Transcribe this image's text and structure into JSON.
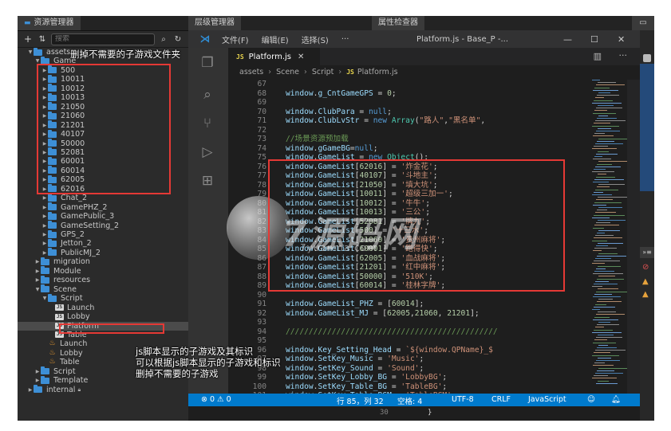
{
  "assets_panel": {
    "title": "资源管理器",
    "search_placeholder": "搜索",
    "rows": [
      {
        "label": "assets",
        "level": 0,
        "type": "folder",
        "expanded": true
      },
      {
        "label": "Game",
        "level": 1,
        "type": "folder",
        "expanded": true
      },
      {
        "label": "500",
        "level": 2,
        "type": "folder"
      },
      {
        "label": "10011",
        "level": 2,
        "type": "folder"
      },
      {
        "label": "10012",
        "level": 2,
        "type": "folder"
      },
      {
        "label": "10013",
        "level": 2,
        "type": "folder"
      },
      {
        "label": "21050",
        "level": 2,
        "type": "folder"
      },
      {
        "label": "21060",
        "level": 2,
        "type": "folder"
      },
      {
        "label": "21201",
        "level": 2,
        "type": "folder"
      },
      {
        "label": "40107",
        "level": 2,
        "type": "folder"
      },
      {
        "label": "50000",
        "level": 2,
        "type": "folder"
      },
      {
        "label": "52081",
        "level": 2,
        "type": "folder"
      },
      {
        "label": "60001",
        "level": 2,
        "type": "folder"
      },
      {
        "label": "60014",
        "level": 2,
        "type": "folder"
      },
      {
        "label": "62005",
        "level": 2,
        "type": "folder"
      },
      {
        "label": "62016",
        "level": 2,
        "type": "folder"
      },
      {
        "label": "Chat_2",
        "level": 2,
        "type": "folder"
      },
      {
        "label": "GamePHZ_2",
        "level": 2,
        "type": "folder"
      },
      {
        "label": "GamePublic_3",
        "level": 2,
        "type": "folder"
      },
      {
        "label": "GameSetting_2",
        "level": 2,
        "type": "folder"
      },
      {
        "label": "GPS_2",
        "level": 2,
        "type": "folder"
      },
      {
        "label": "Jetton_2",
        "level": 2,
        "type": "folder"
      },
      {
        "label": "PublicMJ_2",
        "level": 2,
        "type": "folder"
      },
      {
        "label": "migration",
        "level": 1,
        "type": "folder"
      },
      {
        "label": "Module",
        "level": 1,
        "type": "folder"
      },
      {
        "label": "resources",
        "level": 1,
        "type": "folder"
      },
      {
        "label": "Scene",
        "level": 1,
        "type": "folder",
        "expanded": true
      },
      {
        "label": "Script",
        "level": 2,
        "type": "folder",
        "expanded": true
      },
      {
        "label": "Launch",
        "level": 3,
        "type": "js"
      },
      {
        "label": "Lobby",
        "level": 3,
        "type": "js"
      },
      {
        "label": "Platform",
        "level": 3,
        "type": "js",
        "selected": true
      },
      {
        "label": "Table",
        "level": 3,
        "type": "js"
      },
      {
        "label": "Launch",
        "level": 2,
        "type": "fire"
      },
      {
        "label": "Lobby",
        "level": 2,
        "type": "fire"
      },
      {
        "label": "Table",
        "level": 2,
        "type": "fire"
      },
      {
        "label": "Script",
        "level": 1,
        "type": "folder"
      },
      {
        "label": "Template",
        "level": 1,
        "type": "folder"
      },
      {
        "label": "internal",
        "level": 0,
        "type": "folder",
        "locked": true
      }
    ]
  },
  "hierarchy_panel": {
    "title": "层级管理器"
  },
  "properties_panel": {
    "title": "属性检查器"
  },
  "vscode": {
    "menu": [
      "文件(F)",
      "编辑(E)",
      "选择(S)"
    ],
    "window_title": "Platform.js - Base_P -...",
    "tab": {
      "label": "Platform.js",
      "icon": "JS"
    },
    "breadcrumbs": [
      "assets",
      "Scene",
      "Script",
      "Platform.js"
    ],
    "code": [
      {
        "n": "67",
        "tokens": []
      },
      {
        "n": "68",
        "tokens": [
          [
            "id",
            "window"
          ],
          [
            "pl",
            "."
          ],
          [
            "id",
            "g_CntGameGPS"
          ],
          [
            "pl",
            " = "
          ],
          [
            "num",
            "0"
          ],
          [
            "pl",
            ";"
          ]
        ]
      },
      {
        "n": "69",
        "tokens": []
      },
      {
        "n": "70",
        "tokens": [
          [
            "id",
            "window"
          ],
          [
            "pl",
            "."
          ],
          [
            "id",
            "ClubPara"
          ],
          [
            "pl",
            " = "
          ],
          [
            "kw",
            "null"
          ],
          [
            "pl",
            ";"
          ]
        ]
      },
      {
        "n": "71",
        "tokens": [
          [
            "id",
            "window"
          ],
          [
            "pl",
            "."
          ],
          [
            "id",
            "ClubLvStr"
          ],
          [
            "pl",
            " = "
          ],
          [
            "kw",
            "new "
          ],
          [
            "fn",
            "Array"
          ],
          [
            "pl",
            "("
          ],
          [
            "str",
            "\"路人\""
          ],
          [
            "pl",
            ","
          ],
          [
            "str",
            "\"黑名单\""
          ],
          [
            "pl",
            ","
          ]
        ]
      },
      {
        "n": "72",
        "tokens": []
      },
      {
        "n": "73",
        "tokens": [
          [
            "cm",
            "//场景资源预加载"
          ]
        ]
      },
      {
        "n": "74",
        "tokens": [
          [
            "id",
            "window"
          ],
          [
            "pl",
            "."
          ],
          [
            "id",
            "gGameBG"
          ],
          [
            "pl",
            "="
          ],
          [
            "kw",
            "null"
          ],
          [
            "pl",
            ";"
          ]
        ]
      },
      {
        "n": "75",
        "tokens": [
          [
            "id",
            "window"
          ],
          [
            "pl",
            "."
          ],
          [
            "id",
            "GameList"
          ],
          [
            "pl",
            " = "
          ],
          [
            "kw",
            "new "
          ],
          [
            "fn",
            "Object"
          ],
          [
            "pl",
            "();"
          ]
        ]
      },
      {
        "n": "76",
        "tokens": [
          [
            "id",
            "window"
          ],
          [
            "pl",
            "."
          ],
          [
            "id",
            "GameList"
          ],
          [
            "pl",
            "["
          ],
          [
            "num",
            "62016"
          ],
          [
            "pl",
            "] = "
          ],
          [
            "str",
            "'炸金花'"
          ],
          [
            "pl",
            ";"
          ]
        ]
      },
      {
        "n": "77",
        "tokens": [
          [
            "id",
            "window"
          ],
          [
            "pl",
            "."
          ],
          [
            "id",
            "GameList"
          ],
          [
            "pl",
            "["
          ],
          [
            "num",
            "40107"
          ],
          [
            "pl",
            "] = "
          ],
          [
            "str",
            "'斗地主'"
          ],
          [
            "pl",
            ";"
          ]
        ]
      },
      {
        "n": "78",
        "tokens": [
          [
            "id",
            "window"
          ],
          [
            "pl",
            "."
          ],
          [
            "id",
            "GameList"
          ],
          [
            "pl",
            "["
          ],
          [
            "num",
            "21050"
          ],
          [
            "pl",
            "] = "
          ],
          [
            "str",
            "'填大坑'"
          ],
          [
            "pl",
            ";"
          ]
        ]
      },
      {
        "n": "79",
        "tokens": [
          [
            "id",
            "window"
          ],
          [
            "pl",
            "."
          ],
          [
            "id",
            "GameList"
          ],
          [
            "pl",
            "["
          ],
          [
            "num",
            "10011"
          ],
          [
            "pl",
            "] = "
          ],
          [
            "str",
            "'超级三加一'"
          ],
          [
            "pl",
            ";"
          ]
        ]
      },
      {
        "n": "80",
        "tokens": [
          [
            "id",
            "window"
          ],
          [
            "pl",
            "."
          ],
          [
            "id",
            "GameList"
          ],
          [
            "pl",
            "["
          ],
          [
            "num",
            "10012"
          ],
          [
            "pl",
            "] = "
          ],
          [
            "str",
            "'牛牛'"
          ],
          [
            "pl",
            ";"
          ]
        ]
      },
      {
        "n": "81",
        "tokens": [
          [
            "id",
            "window"
          ],
          [
            "pl",
            "."
          ],
          [
            "id",
            "GameList"
          ],
          [
            "pl",
            "["
          ],
          [
            "num",
            "10013"
          ],
          [
            "pl",
            "] = "
          ],
          [
            "str",
            "'三公'"
          ],
          [
            "pl",
            ";"
          ]
        ]
      },
      {
        "n": "82",
        "tokens": [
          [
            "id",
            "window"
          ],
          [
            "pl",
            "."
          ],
          [
            "id",
            "GameList"
          ],
          [
            "pl",
            "["
          ],
          [
            "num",
            "52081"
          ],
          [
            "pl",
            "] = "
          ],
          [
            "str",
            "'牌九'"
          ],
          [
            "pl",
            ";"
          ]
        ]
      },
      {
        "n": "83",
        "tokens": [
          [
            "id",
            "window"
          ],
          [
            "pl",
            "."
          ],
          [
            "id",
            "GameList"
          ],
          [
            "pl",
            "["
          ],
          [
            "num",
            "500"
          ],
          [
            "pl",
            "] = "
          ],
          [
            "str",
            "'十三水'"
          ],
          [
            "pl",
            ";"
          ]
        ]
      },
      {
        "n": "84",
        "tokens": [
          [
            "id",
            "window"
          ],
          [
            "pl",
            "."
          ],
          [
            "id",
            "GameList"
          ],
          [
            "pl",
            "["
          ],
          [
            "num",
            "21060"
          ],
          [
            "pl",
            "] = "
          ],
          [
            "str",
            "'贵州麻将'"
          ],
          [
            "pl",
            ";"
          ]
        ]
      },
      {
        "n": "85",
        "tokens": [
          [
            "id",
            "window"
          ],
          [
            "pl",
            "."
          ],
          [
            "id",
            "GameList"
          ],
          [
            "pl",
            "["
          ],
          [
            "num",
            "60001"
          ],
          [
            "pl",
            "] = "
          ],
          [
            "str",
            "'跑得快'"
          ],
          [
            "pl",
            ";"
          ]
        ]
      },
      {
        "n": "86",
        "tokens": [
          [
            "id",
            "window"
          ],
          [
            "pl",
            "."
          ],
          [
            "id",
            "GameList"
          ],
          [
            "pl",
            "["
          ],
          [
            "num",
            "62005"
          ],
          [
            "pl",
            "] = "
          ],
          [
            "str",
            "'血战麻将'"
          ],
          [
            "pl",
            ";"
          ]
        ]
      },
      {
        "n": "87",
        "tokens": [
          [
            "id",
            "window"
          ],
          [
            "pl",
            "."
          ],
          [
            "id",
            "GameList"
          ],
          [
            "pl",
            "["
          ],
          [
            "num",
            "21201"
          ],
          [
            "pl",
            "] = "
          ],
          [
            "str",
            "'红中麻将'"
          ],
          [
            "pl",
            ";"
          ]
        ]
      },
      {
        "n": "88",
        "tokens": [
          [
            "id",
            "window"
          ],
          [
            "pl",
            "."
          ],
          [
            "id",
            "GameList"
          ],
          [
            "pl",
            "["
          ],
          [
            "num",
            "50000"
          ],
          [
            "pl",
            "] = "
          ],
          [
            "str",
            "'510K'"
          ],
          [
            "pl",
            ";"
          ]
        ]
      },
      {
        "n": "89",
        "tokens": [
          [
            "id",
            "window"
          ],
          [
            "pl",
            "."
          ],
          [
            "id",
            "GameList"
          ],
          [
            "pl",
            "["
          ],
          [
            "num",
            "60014"
          ],
          [
            "pl",
            "] = "
          ],
          [
            "str",
            "'桂林字牌'"
          ],
          [
            "pl",
            ";"
          ]
        ]
      },
      {
        "n": "90",
        "tokens": []
      },
      {
        "n": "91",
        "tokens": [
          [
            "id",
            "window"
          ],
          [
            "pl",
            "."
          ],
          [
            "id",
            "GameList_PHZ"
          ],
          [
            "pl",
            " = ["
          ],
          [
            "num",
            "60014"
          ],
          [
            "pl",
            "];"
          ]
        ]
      },
      {
        "n": "92",
        "tokens": [
          [
            "id",
            "window"
          ],
          [
            "pl",
            "."
          ],
          [
            "id",
            "GameList_MJ"
          ],
          [
            "pl",
            " = ["
          ],
          [
            "num",
            "62005"
          ],
          [
            "pl",
            ","
          ],
          [
            "num",
            "21060"
          ],
          [
            "pl",
            ", "
          ],
          [
            "num",
            "21201"
          ],
          [
            "pl",
            "];"
          ]
        ]
      },
      {
        "n": "93",
        "tokens": []
      },
      {
        "n": "94",
        "tokens": [
          [
            "cm",
            "//////////////////////////////////////////////"
          ]
        ]
      },
      {
        "n": "95",
        "tokens": []
      },
      {
        "n": "96",
        "tokens": [
          [
            "id",
            "window"
          ],
          [
            "pl",
            "."
          ],
          [
            "id",
            "Key_Setting_Head"
          ],
          [
            "pl",
            " = "
          ],
          [
            "str",
            "`${window.QPName}_$"
          ]
        ]
      },
      {
        "n": "97",
        "tokens": [
          [
            "id",
            "window"
          ],
          [
            "pl",
            "."
          ],
          [
            "id",
            "SetKey_Music"
          ],
          [
            "pl",
            " = "
          ],
          [
            "str",
            "'Music'"
          ],
          [
            "pl",
            ";"
          ]
        ]
      },
      {
        "n": "98",
        "tokens": [
          [
            "id",
            "window"
          ],
          [
            "pl",
            "."
          ],
          [
            "id",
            "SetKey_Sound"
          ],
          [
            "pl",
            " = "
          ],
          [
            "str",
            "'Sound'"
          ],
          [
            "pl",
            ";"
          ]
        ]
      },
      {
        "n": "99",
        "tokens": [
          [
            "id",
            "window"
          ],
          [
            "pl",
            "."
          ],
          [
            "id",
            "SetKey_Lobby_BG"
          ],
          [
            "pl",
            " = "
          ],
          [
            "str",
            "'LobbyBG'"
          ],
          [
            "pl",
            ";"
          ]
        ]
      },
      {
        "n": "100",
        "tokens": [
          [
            "id",
            "window"
          ],
          [
            "pl",
            "."
          ],
          [
            "id",
            "SetKey_Table_BG"
          ],
          [
            "pl",
            " = "
          ],
          [
            "str",
            "'TableBG'"
          ],
          [
            "pl",
            ";"
          ]
        ]
      },
      {
        "n": "101",
        "tokens": [
          [
            "id",
            "window"
          ],
          [
            "pl",
            "."
          ],
          [
            "id",
            "SetKey_Table_BGM"
          ],
          [
            "pl",
            " = "
          ],
          [
            "str",
            "'TableBGM'"
          ],
          [
            "pl",
            ";"
          ]
        ]
      }
    ],
    "status": {
      "problems": "⊗ 0 ⚠ 0",
      "position": "行 85，列 32",
      "spaces": "空格: 4",
      "encoding": "UTF-8",
      "eol": "CRLF",
      "language": "JavaScript"
    },
    "below_status": {
      "line": "30",
      "text": "}"
    }
  },
  "annotations": {
    "top": "删掉不需要的子游戏文件夹",
    "bottom": [
      "js脚本显示的子游戏及其标识",
      "可以根据js脚本显示的子游戏和标识",
      "删掉不需要的子游戏"
    ]
  },
  "watermark": {
    "text": "7源码网",
    "sub": "7yuanma.com"
  },
  "colors": {
    "status_bar": "#007acc",
    "folder": "#3d8fd6",
    "annotation_box": "#e53935"
  }
}
